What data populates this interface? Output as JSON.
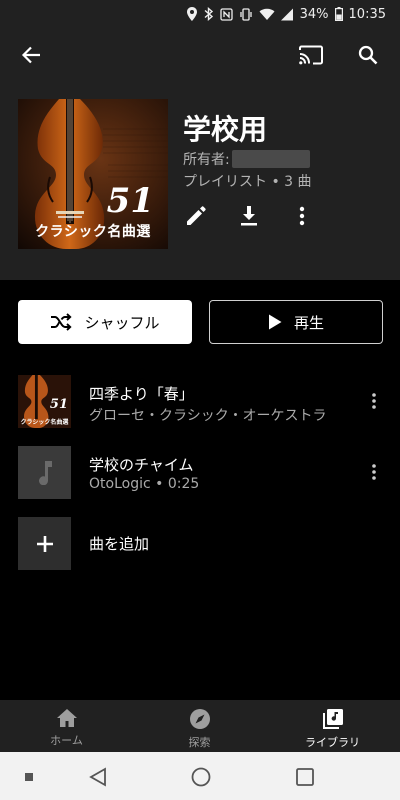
{
  "status_bar": {
    "battery_percent": "34%",
    "time": "10:35"
  },
  "top_bar": {
    "back_icon": "arrow-back-icon",
    "cast_icon": "cast-icon",
    "search_icon": "search-icon"
  },
  "playlist": {
    "title": "学校用",
    "owner_label": "所有者:",
    "meta": "プレイリスト • 3 曲",
    "art": {
      "number": "51",
      "title": "クラシック名曲選"
    }
  },
  "actions": {
    "edit_icon": "edit-pencil-icon",
    "download_icon": "download-icon",
    "more_icon": "more-vert-icon"
  },
  "buttons": {
    "shuffle_label": "シャッフル",
    "play_label": "再生"
  },
  "tracks": [
    {
      "title": "四季より「春」",
      "subtitle": "グローセ・クラシック・オーケストラ",
      "thumb_number": "51",
      "thumb_title": "クラシック名曲選"
    },
    {
      "title": "学校のチャイム",
      "subtitle": "OtoLogic • 0:25"
    }
  ],
  "add_song": {
    "label": "曲を追加"
  },
  "bottom_nav": [
    {
      "label": "ホーム",
      "icon": "home-icon",
      "active": false
    },
    {
      "label": "探索",
      "icon": "compass-icon",
      "active": false
    },
    {
      "label": "ライブラリ",
      "icon": "library-icon",
      "active": true
    }
  ],
  "colors": {
    "background": "#000000",
    "surface": "#212121",
    "text_secondary": "#aaaaaa"
  }
}
